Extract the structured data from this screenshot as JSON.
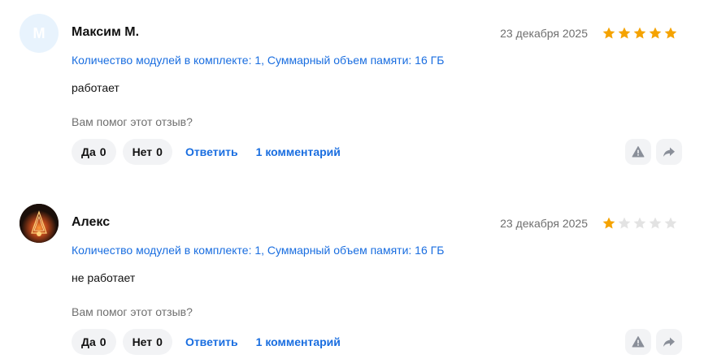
{
  "reviews": [
    {
      "avatar_initial": "M",
      "author": "Максим М.",
      "date": "23 декабря 2025",
      "rating": 5,
      "params": "Количество модулей в комплекте: 1, Суммарный объем памяти: 16 ГБ",
      "text": "работает",
      "helpful_prompt": "Вам помог этот отзыв?",
      "yes_label": "Да",
      "yes_count": "0",
      "no_label": "Нет",
      "no_count": "0",
      "reply_label": "Ответить",
      "comments_label": "1 комментарий"
    },
    {
      "avatar_initial": "",
      "author": "Алекс",
      "date": "23 декабря 2025",
      "rating": 1,
      "params": "Количество модулей в комплекте: 1, Суммарный объем памяти: 16 ГБ",
      "text": "не работает",
      "helpful_prompt": "Вам помог этот отзыв?",
      "yes_label": "Да",
      "yes_count": "0",
      "no_label": "Нет",
      "no_count": "0",
      "reply_label": "Ответить",
      "comments_label": "1 комментарий"
    }
  ],
  "colors": {
    "star_filled": "#f5a300",
    "star_empty": "#e3e3e3",
    "link": "#1a6ee0",
    "avatar_bg": "#e8f3fd"
  },
  "icons": {
    "report": "warning-icon",
    "share": "share-arrow-icon",
    "star": "star-icon"
  }
}
